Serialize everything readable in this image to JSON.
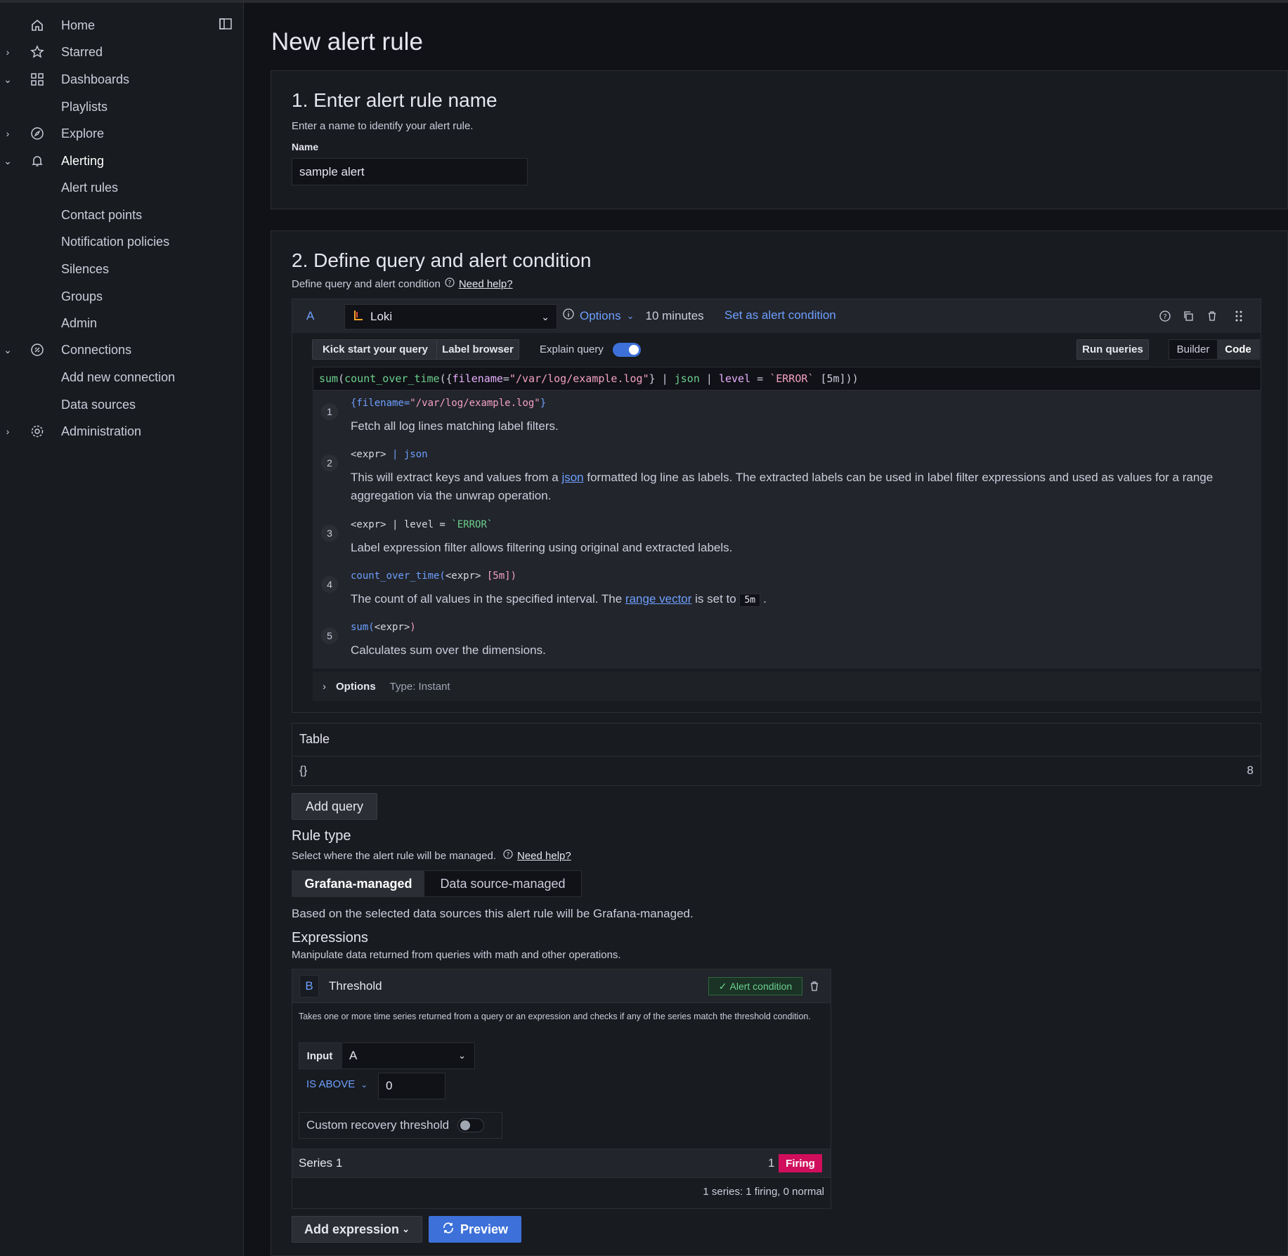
{
  "sidebar": {
    "items": [
      {
        "label": "Home",
        "icon": "home-icon"
      },
      {
        "label": "Starred",
        "icon": "star-icon"
      },
      {
        "label": "Dashboards",
        "icon": "apps-icon"
      },
      {
        "label": "Playlists"
      },
      {
        "label": "Explore",
        "icon": "compass-icon"
      },
      {
        "label": "Alerting",
        "icon": "bell-icon"
      },
      {
        "label": "Alert rules"
      },
      {
        "label": "Contact points"
      },
      {
        "label": "Notification policies"
      },
      {
        "label": "Silences"
      },
      {
        "label": "Groups"
      },
      {
        "label": "Admin"
      },
      {
        "label": "Connections",
        "icon": "connections-icon"
      },
      {
        "label": "Add new connection"
      },
      {
        "label": "Data sources"
      },
      {
        "label": "Administration",
        "icon": "cog-icon"
      }
    ]
  },
  "page": {
    "title": "New alert rule"
  },
  "section1": {
    "title": "1. Enter alert rule name",
    "description": "Enter a name to identify your alert rule.",
    "name_label": "Name",
    "name_value": "sample alert"
  },
  "section2": {
    "title": "2. Define query and alert condition",
    "description": "Define query and alert condition",
    "need_help": "Need help?",
    "query": {
      "ref": "A",
      "datasource": "Loki",
      "options_label": "Options",
      "time_range": "10 minutes",
      "set_condition": "Set as alert condition",
      "kick_start": "Kick start your query",
      "label_browser": "Label browser",
      "explain_query": "Explain query",
      "run_queries": "Run queries",
      "builder": "Builder",
      "code": "Code",
      "expr_fn1": "sum",
      "expr_fn2": "count_over_time",
      "expr_lbl": "filename",
      "expr_str": "\"/var/log/example.log\"",
      "expr_rest1": "json",
      "expr_rest2": "level",
      "expr_val": "`ERROR`",
      "expr_range": "[5m]",
      "steps": [
        {
          "num": "1",
          "code_a": "{filename=",
          "code_b": "\"/var/log/example.log\"",
          "code_c": "}",
          "text": "Fetch all log lines matching label filters."
        },
        {
          "num": "2",
          "code_a": "<expr>",
          "code_b": " | ",
          "code_c": "json",
          "text_a": "This will extract keys and values from a ",
          "text_link": "json",
          "text_b": " formatted log line as labels. The extracted labels can be used in label filter expressions and used as values for a range aggregation via the unwrap operation."
        },
        {
          "num": "3",
          "code_a": "<expr>",
          "code_b": " | level = ",
          "code_c": "`ERROR`",
          "text": "Label expression filter allows filtering using original and extracted labels."
        },
        {
          "num": "4",
          "code_a": "count_over_time(",
          "code_b": "<expr>",
          "code_c": " [5m])",
          "text_a": "The count of all values in the specified interval. The ",
          "text_link": "range vector",
          "text_b": " is set to ",
          "text_chip": "5m",
          "text_c": "."
        },
        {
          "num": "5",
          "code_a": "sum(",
          "code_b": "<expr>",
          "code_c": ")",
          "text": "Calculates sum over the dimensions."
        }
      ],
      "options_row_label": "Options",
      "options_type": "Type: Instant"
    },
    "table": {
      "title": "Table",
      "row_key": "{}",
      "row_value": "8"
    },
    "add_query": "Add query",
    "rule_type": {
      "title": "Rule type",
      "description": "Select where the alert rule will be managed.",
      "need_help": "Need help?",
      "options": [
        "Grafana-managed",
        "Data source-managed"
      ],
      "note": "Based on the selected data sources this alert rule will be Grafana-managed."
    },
    "expressions": {
      "title": "Expressions",
      "description": "Manipulate data returned from queries with math and other operations.",
      "ref": "B",
      "name": "Threshold",
      "alert_condition": "Alert condition",
      "help": "Takes one or more time series returned from a query or an expression and checks if any of the series match the threshold condition.",
      "input_label": "Input",
      "input_value": "A",
      "operator": "IS ABOVE",
      "threshold_value": "0",
      "recovery_label": "Custom recovery threshold",
      "series_name": "Series 1",
      "series_value": "1",
      "series_state": "Firing",
      "summary": "1 series: 1 firing, 0 normal"
    },
    "add_expression": "Add expression",
    "preview": "Preview"
  },
  "colors": {
    "background": "#111217",
    "panel": "#181b1f",
    "link": "#6e9fff",
    "primary": "#3d71d9",
    "firing": "#d10e5c",
    "success": "#6ccf8e"
  }
}
